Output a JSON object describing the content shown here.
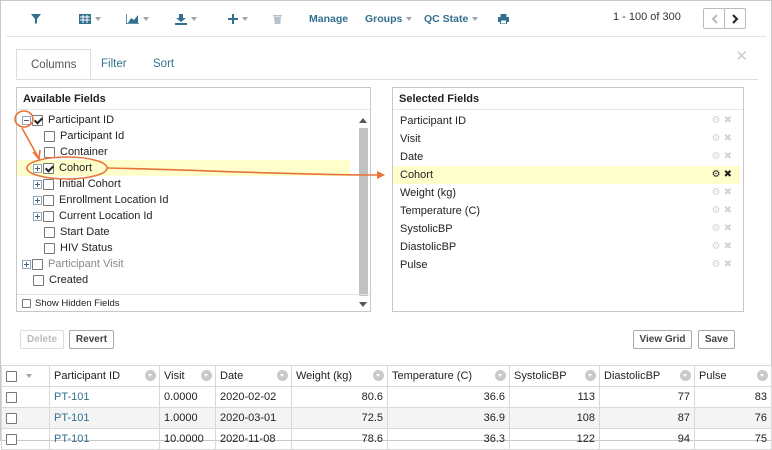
{
  "toolbar": {
    "manage_label": "Manage",
    "groups_label": "Groups",
    "qc_state_label": "QC State",
    "paging_text": "1 - 100 of 300"
  },
  "customize": {
    "tabs": [
      "Columns",
      "Filter",
      "Sort"
    ],
    "available_title": "Available Fields",
    "selected_title": "Selected Fields",
    "tree": [
      {
        "label": "Participant ID",
        "checked": true,
        "expander": "minus",
        "level": 0
      },
      {
        "label": "Participant Id",
        "checked": false,
        "expander": "none",
        "level": 1
      },
      {
        "label": "Container",
        "checked": false,
        "expander": "none",
        "level": 1
      },
      {
        "label": "Cohort",
        "checked": true,
        "expander": "plus",
        "level": 1,
        "highlighted": true
      },
      {
        "label": "Initial Cohort",
        "checked": false,
        "expander": "plus",
        "level": 1
      },
      {
        "label": "Enrollment Location Id",
        "checked": false,
        "expander": "plus",
        "level": 1
      },
      {
        "label": "Current Location Id",
        "checked": false,
        "expander": "plus",
        "level": 1
      },
      {
        "label": "Start Date",
        "checked": false,
        "expander": "none",
        "level": 1
      },
      {
        "label": "HIV Status",
        "checked": false,
        "expander": "none",
        "level": 1
      },
      {
        "label": "Participant Visit",
        "checked": false,
        "expander": "plus",
        "level": 0,
        "grey": true
      },
      {
        "label": "Created",
        "checked": false,
        "expander": "none",
        "level": 0
      }
    ],
    "show_hidden_label": "Show Hidden Fields",
    "selected": [
      "Participant ID",
      "Visit",
      "Date",
      "Cohort",
      "Weight (kg)",
      "Temperature (C)",
      "SystolicBP",
      "DiastolicBP",
      "Pulse"
    ],
    "selected_highlight_index": 3,
    "buttons": {
      "delete": "Delete",
      "revert": "Revert",
      "view_grid": "View Grid",
      "save": "Save"
    }
  },
  "grid": {
    "columns": [
      "Participant ID",
      "Visit",
      "Date",
      "Weight (kg)",
      "Temperature (C)",
      "SystolicBP",
      "DiastolicBP",
      "Pulse"
    ],
    "rows": [
      [
        "PT-101",
        "0.0000",
        "2020-02-02",
        "80.6",
        "36.6",
        "113",
        "77",
        "83"
      ],
      [
        "PT-101",
        "1.0000",
        "2020-03-01",
        "72.5",
        "36.9",
        "108",
        "87",
        "76"
      ],
      [
        "PT-101",
        "10.0000",
        "2020-11-08",
        "78.6",
        "36.3",
        "122",
        "94",
        "75"
      ]
    ]
  },
  "colors": {
    "link": "#31708f",
    "highlight": "#ffffcc",
    "annotation": "#e8733a"
  }
}
